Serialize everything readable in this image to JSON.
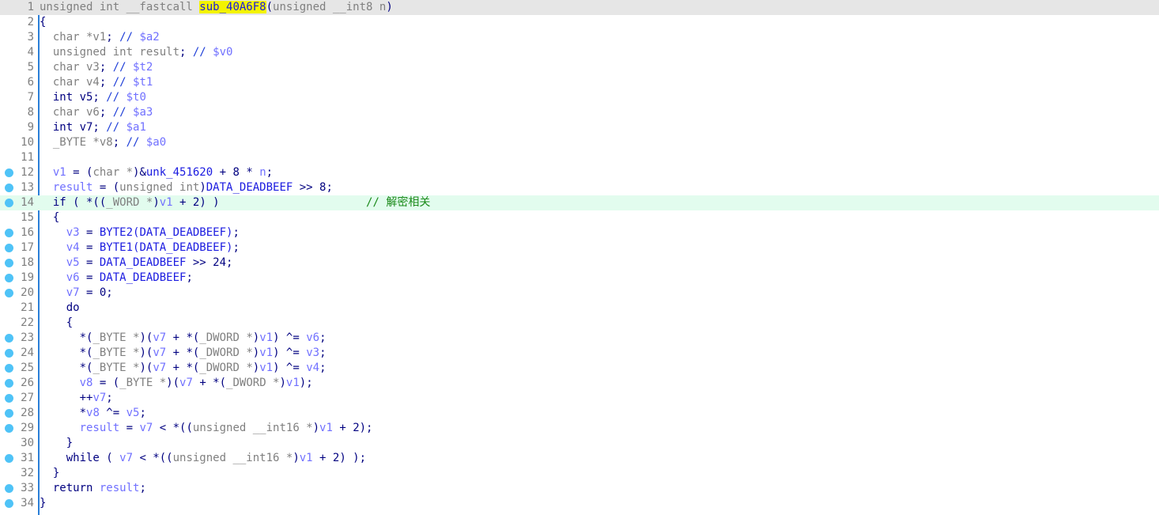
{
  "editor": {
    "function_name": "sub_40A6F8",
    "cursor_line": 1,
    "highlighted_line": 14,
    "colors": {
      "gutter_separator": "#2b7fd8",
      "breakpoint_dot": "#4fc3f7",
      "current_line_bg": "#e6e6e6",
      "highlight_line_bg": "#e2fcee",
      "name_highlight": "#f3f300"
    },
    "lines": [
      {
        "n": "1",
        "bp": false,
        "tokens": [
          [
            "ty",
            "unsigned int __fastcall "
          ],
          [
            "fnhl",
            "sub_40A6F8"
          ],
          [
            "kw",
            "("
          ],
          [
            "ty",
            "unsigned __int8 "
          ],
          [
            "ty",
            "n"
          ],
          [
            "kw",
            ")"
          ]
        ]
      },
      {
        "n": "2",
        "bp": false,
        "tokens": [
          [
            "kw",
            "{"
          ]
        ]
      },
      {
        "n": "3",
        "bp": false,
        "tokens": [
          [
            "ty",
            "  char *v1"
          ],
          [
            "kw",
            "; "
          ],
          [
            "cmt",
            "// "
          ],
          [
            "reg",
            "$a2"
          ]
        ]
      },
      {
        "n": "4",
        "bp": false,
        "tokens": [
          [
            "ty",
            "  unsigned int result"
          ],
          [
            "kw",
            "; "
          ],
          [
            "cmt",
            "// "
          ],
          [
            "reg",
            "$v0"
          ]
        ]
      },
      {
        "n": "5",
        "bp": false,
        "tokens": [
          [
            "ty",
            "  char v3"
          ],
          [
            "kw",
            "; "
          ],
          [
            "cmt",
            "// "
          ],
          [
            "reg",
            "$t2"
          ]
        ]
      },
      {
        "n": "6",
        "bp": false,
        "tokens": [
          [
            "ty",
            "  char v4"
          ],
          [
            "kw",
            "; "
          ],
          [
            "cmt",
            "// "
          ],
          [
            "reg",
            "$t1"
          ]
        ]
      },
      {
        "n": "7",
        "bp": false,
        "tokens": [
          [
            "kw",
            "  int v5; "
          ],
          [
            "cmt",
            "// "
          ],
          [
            "reg",
            "$t0"
          ]
        ]
      },
      {
        "n": "8",
        "bp": false,
        "tokens": [
          [
            "ty",
            "  char v6"
          ],
          [
            "kw",
            "; "
          ],
          [
            "cmt",
            "// "
          ],
          [
            "reg",
            "$a3"
          ]
        ]
      },
      {
        "n": "9",
        "bp": false,
        "tokens": [
          [
            "kw",
            "  int v7; "
          ],
          [
            "cmt",
            "// "
          ],
          [
            "reg",
            "$a1"
          ]
        ]
      },
      {
        "n": "10",
        "bp": false,
        "tokens": [
          [
            "ty",
            "  _BYTE *v8"
          ],
          [
            "kw",
            "; "
          ],
          [
            "cmt",
            "// "
          ],
          [
            "reg",
            "$a0"
          ]
        ]
      },
      {
        "n": "11",
        "bp": false,
        "tokens": []
      },
      {
        "n": "12",
        "bp": true,
        "tokens": [
          [
            "var",
            "  v1"
          ],
          [
            "kw",
            " = ("
          ],
          [
            "ty",
            "char *"
          ],
          [
            "kw",
            ")&"
          ],
          [
            "gl",
            "unk_451620"
          ],
          [
            "kw",
            " + 8 * "
          ],
          [
            "var",
            "n"
          ],
          [
            "kw",
            ";"
          ]
        ]
      },
      {
        "n": "13",
        "bp": true,
        "tokens": [
          [
            "var",
            "  result"
          ],
          [
            "kw",
            " = ("
          ],
          [
            "ty",
            "unsigned int"
          ],
          [
            "kw",
            ")"
          ],
          [
            "gl",
            "DATA_DEADBEEF"
          ],
          [
            "kw",
            " >> 8;"
          ]
        ]
      },
      {
        "n": "14",
        "bp": true,
        "tokens": [
          [
            "kw",
            "  if ( *(("
          ],
          [
            "ty",
            "_WORD *"
          ],
          [
            "kw",
            ")"
          ],
          [
            "var",
            "v1"
          ],
          [
            "kw",
            " + 2) )                      "
          ],
          [
            "zhc",
            "// 解密相关"
          ]
        ]
      },
      {
        "n": "15",
        "bp": false,
        "tokens": [
          [
            "kw",
            "  {"
          ]
        ]
      },
      {
        "n": "16",
        "bp": true,
        "tokens": [
          [
            "var",
            "    v3"
          ],
          [
            "kw",
            " = "
          ],
          [
            "gl",
            "BYTE2(DATA_DEADBEEF)"
          ],
          [
            "kw",
            ";"
          ]
        ]
      },
      {
        "n": "17",
        "bp": true,
        "tokens": [
          [
            "var",
            "    v4"
          ],
          [
            "kw",
            " = "
          ],
          [
            "gl",
            "BYTE1(DATA_DEADBEEF)"
          ],
          [
            "kw",
            ";"
          ]
        ]
      },
      {
        "n": "18",
        "bp": true,
        "tokens": [
          [
            "var",
            "    v5"
          ],
          [
            "kw",
            " = "
          ],
          [
            "gl",
            "DATA_DEADBEEF"
          ],
          [
            "kw",
            " >> 24;"
          ]
        ]
      },
      {
        "n": "19",
        "bp": true,
        "tokens": [
          [
            "var",
            "    v6"
          ],
          [
            "kw",
            " = "
          ],
          [
            "gl",
            "DATA_DEADBEEF"
          ],
          [
            "kw",
            ";"
          ]
        ]
      },
      {
        "n": "20",
        "bp": true,
        "tokens": [
          [
            "var",
            "    v7"
          ],
          [
            "kw",
            " = 0;"
          ]
        ]
      },
      {
        "n": "21",
        "bp": false,
        "tokens": [
          [
            "kw",
            "    do"
          ]
        ]
      },
      {
        "n": "22",
        "bp": false,
        "tokens": [
          [
            "kw",
            "    {"
          ]
        ]
      },
      {
        "n": "23",
        "bp": true,
        "tokens": [
          [
            "kw",
            "      *("
          ],
          [
            "ty",
            "_BYTE *"
          ],
          [
            "kw",
            ")("
          ],
          [
            "var",
            "v7"
          ],
          [
            "kw",
            " + *("
          ],
          [
            "ty",
            "_DWORD *"
          ],
          [
            "kw",
            ")"
          ],
          [
            "var",
            "v1"
          ],
          [
            "kw",
            ") ^= "
          ],
          [
            "var",
            "v6"
          ],
          [
            "kw",
            ";"
          ]
        ]
      },
      {
        "n": "24",
        "bp": true,
        "tokens": [
          [
            "kw",
            "      *("
          ],
          [
            "ty",
            "_BYTE *"
          ],
          [
            "kw",
            ")("
          ],
          [
            "var",
            "v7"
          ],
          [
            "kw",
            " + *("
          ],
          [
            "ty",
            "_DWORD *"
          ],
          [
            "kw",
            ")"
          ],
          [
            "var",
            "v1"
          ],
          [
            "kw",
            ") ^= "
          ],
          [
            "var",
            "v3"
          ],
          [
            "kw",
            ";"
          ]
        ]
      },
      {
        "n": "25",
        "bp": true,
        "tokens": [
          [
            "kw",
            "      *("
          ],
          [
            "ty",
            "_BYTE *"
          ],
          [
            "kw",
            ")("
          ],
          [
            "var",
            "v7"
          ],
          [
            "kw",
            " + *("
          ],
          [
            "ty",
            "_DWORD *"
          ],
          [
            "kw",
            ")"
          ],
          [
            "var",
            "v1"
          ],
          [
            "kw",
            ") ^= "
          ],
          [
            "var",
            "v4"
          ],
          [
            "kw",
            ";"
          ]
        ]
      },
      {
        "n": "26",
        "bp": true,
        "tokens": [
          [
            "var",
            "      v8"
          ],
          [
            "kw",
            " = ("
          ],
          [
            "ty",
            "_BYTE *"
          ],
          [
            "kw",
            ")("
          ],
          [
            "var",
            "v7"
          ],
          [
            "kw",
            " + *("
          ],
          [
            "ty",
            "_DWORD *"
          ],
          [
            "kw",
            ")"
          ],
          [
            "var",
            "v1"
          ],
          [
            "kw",
            ");"
          ]
        ]
      },
      {
        "n": "27",
        "bp": true,
        "tokens": [
          [
            "kw",
            "      ++"
          ],
          [
            "var",
            "v7"
          ],
          [
            "kw",
            ";"
          ]
        ]
      },
      {
        "n": "28",
        "bp": true,
        "tokens": [
          [
            "kw",
            "      *"
          ],
          [
            "var",
            "v8"
          ],
          [
            "kw",
            " ^= "
          ],
          [
            "var",
            "v5"
          ],
          [
            "kw",
            ";"
          ]
        ]
      },
      {
        "n": "29",
        "bp": true,
        "tokens": [
          [
            "var",
            "      result"
          ],
          [
            "kw",
            " = "
          ],
          [
            "var",
            "v7"
          ],
          [
            "kw",
            " < *(("
          ],
          [
            "ty",
            "unsigned __int16 *"
          ],
          [
            "kw",
            ")"
          ],
          [
            "var",
            "v1"
          ],
          [
            "kw",
            " + 2);"
          ]
        ]
      },
      {
        "n": "30",
        "bp": false,
        "tokens": [
          [
            "kw",
            "    }"
          ]
        ]
      },
      {
        "n": "31",
        "bp": true,
        "tokens": [
          [
            "kw",
            "    while ( "
          ],
          [
            "var",
            "v7"
          ],
          [
            "kw",
            " < *(("
          ],
          [
            "ty",
            "unsigned __int16 *"
          ],
          [
            "kw",
            ")"
          ],
          [
            "var",
            "v1"
          ],
          [
            "kw",
            " + 2) );"
          ]
        ]
      },
      {
        "n": "32",
        "bp": false,
        "tokens": [
          [
            "kw",
            "  }"
          ]
        ]
      },
      {
        "n": "33",
        "bp": true,
        "tokens": [
          [
            "kw",
            "  return "
          ],
          [
            "var",
            "result"
          ],
          [
            "kw",
            ";"
          ]
        ]
      },
      {
        "n": "34",
        "bp": true,
        "tokens": [
          [
            "kw",
            "}"
          ]
        ]
      }
    ]
  }
}
